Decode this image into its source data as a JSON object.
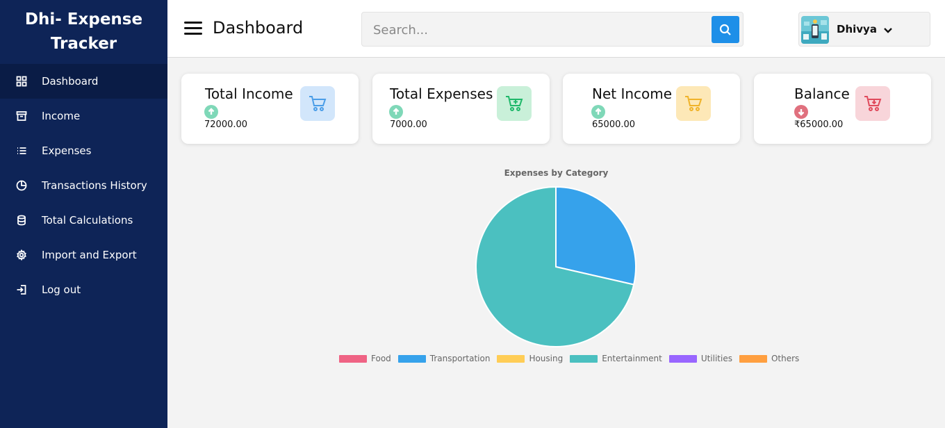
{
  "sidebar": {
    "brand": "Dhi- Expense Tracker",
    "items": [
      {
        "label": "Dashboard",
        "icon": "grid-icon"
      },
      {
        "label": "Income",
        "icon": "archive-icon"
      },
      {
        "label": "Expenses",
        "icon": "list-icon"
      },
      {
        "label": "Transactions History",
        "icon": "pie-chart-icon"
      },
      {
        "label": "Total Calculations",
        "icon": "database-icon"
      },
      {
        "label": "Import and Export",
        "icon": "gear-icon"
      },
      {
        "label": "Log out",
        "icon": "logout-icon"
      }
    ],
    "active_index": 0
  },
  "header": {
    "title": "Dashboard",
    "search_placeholder": "Search...",
    "user_name": "Dhivya"
  },
  "cards": [
    {
      "title": "Total Income",
      "value": "72000.00",
      "trend": "up",
      "arrow_color": "#7fd8b8",
      "icon_bg": "#d2e6fb",
      "icon_color": "#4a9de8",
      "icon": "cart-icon"
    },
    {
      "title": "Total Expenses",
      "value": "7000.00",
      "trend": "up",
      "arrow_color": "#7fd8b8",
      "icon_bg": "#c9f0d9",
      "icon_color": "#1fb86a",
      "icon": "cart-plus-icon"
    },
    {
      "title": "Net Income",
      "value": "65000.00",
      "trend": "up",
      "arrow_color": "#7fd8b8",
      "icon_bg": "#fde8b7",
      "icon_color": "#f0b32a",
      "icon": "cart-icon"
    },
    {
      "title": "Balance",
      "value": "₹65000.00",
      "trend": "down",
      "arrow_color": "#e0707e",
      "icon_bg": "#f8d5da",
      "icon_color": "#e04a5c",
      "icon": "cart-down-icon"
    }
  ],
  "chart_data": {
    "type": "pie",
    "title": "Expenses by Category",
    "categories": [
      "Food",
      "Transportation",
      "Housing",
      "Entertainment",
      "Utilities",
      "Others"
    ],
    "values": [
      0,
      2000,
      0,
      5000,
      0,
      0
    ],
    "colors": [
      "#ef6384",
      "#36a2eb",
      "#ffcd56",
      "#4bc0c0",
      "#9966ff",
      "#ff9f40"
    ],
    "legend_position": "bottom"
  }
}
